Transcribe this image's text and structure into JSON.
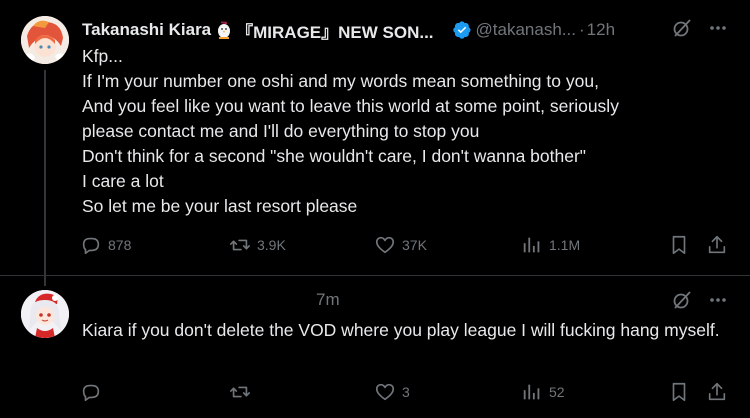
{
  "tweet1": {
    "author_name": "Takanashi Kiara",
    "author_suffix": "『MIRAGE』NEW SON...",
    "handle": "@takanash...",
    "separator": "·",
    "time": "12h",
    "lines": [
      "Kfp...",
      "If I'm your number one oshi and my words mean something to you,",
      "And you feel like you want to leave this world at some point, seriously",
      "please contact me and I'll do everything to stop you",
      "Don't think for a second \"she wouldn't care, I don't wanna bother\"",
      "I care a lot",
      "So let me be your last resort please"
    ],
    "replies": "878",
    "reposts": "3.9K",
    "likes": "37K",
    "views": "1.1M"
  },
  "tweet2": {
    "time": "7m",
    "text": "Kiara if you don't delete the VOD where you play league I will fucking hang myself.",
    "replies": "",
    "reposts": "",
    "likes": "3",
    "views": "52"
  },
  "colors": {
    "background": "#000000",
    "text": "#e7e9ea",
    "muted": "#71767b",
    "verified": "#1d9bf0",
    "divider": "#2f3336"
  },
  "icons": [
    "grok-icon",
    "more-icon",
    "reply-icon",
    "repost-icon",
    "like-icon",
    "views-icon",
    "bookmark-icon",
    "share-icon",
    "verified-badge-icon",
    "chicken-emoji-icon"
  ]
}
